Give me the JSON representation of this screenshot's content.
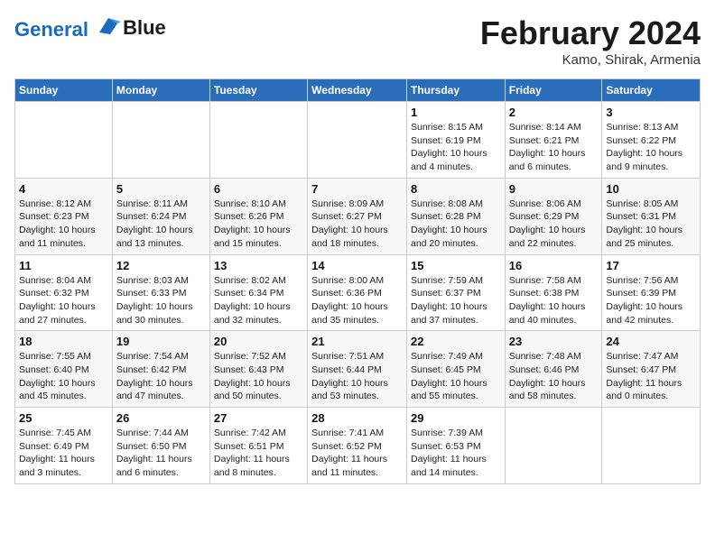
{
  "logo": {
    "line1": "General",
    "line2": "Blue"
  },
  "title": "February 2024",
  "subtitle": "Kamo, Shirak, Armenia",
  "days_of_week": [
    "Sunday",
    "Monday",
    "Tuesday",
    "Wednesday",
    "Thursday",
    "Friday",
    "Saturday"
  ],
  "weeks": [
    [
      {
        "day": "",
        "detail": ""
      },
      {
        "day": "",
        "detail": ""
      },
      {
        "day": "",
        "detail": ""
      },
      {
        "day": "",
        "detail": ""
      },
      {
        "day": "1",
        "detail": "Sunrise: 8:15 AM\nSunset: 6:19 PM\nDaylight: 10 hours\nand 4 minutes."
      },
      {
        "day": "2",
        "detail": "Sunrise: 8:14 AM\nSunset: 6:21 PM\nDaylight: 10 hours\nand 6 minutes."
      },
      {
        "day": "3",
        "detail": "Sunrise: 8:13 AM\nSunset: 6:22 PM\nDaylight: 10 hours\nand 9 minutes."
      }
    ],
    [
      {
        "day": "4",
        "detail": "Sunrise: 8:12 AM\nSunset: 6:23 PM\nDaylight: 10 hours\nand 11 minutes."
      },
      {
        "day": "5",
        "detail": "Sunrise: 8:11 AM\nSunset: 6:24 PM\nDaylight: 10 hours\nand 13 minutes."
      },
      {
        "day": "6",
        "detail": "Sunrise: 8:10 AM\nSunset: 6:26 PM\nDaylight: 10 hours\nand 15 minutes."
      },
      {
        "day": "7",
        "detail": "Sunrise: 8:09 AM\nSunset: 6:27 PM\nDaylight: 10 hours\nand 18 minutes."
      },
      {
        "day": "8",
        "detail": "Sunrise: 8:08 AM\nSunset: 6:28 PM\nDaylight: 10 hours\nand 20 minutes."
      },
      {
        "day": "9",
        "detail": "Sunrise: 8:06 AM\nSunset: 6:29 PM\nDaylight: 10 hours\nand 22 minutes."
      },
      {
        "day": "10",
        "detail": "Sunrise: 8:05 AM\nSunset: 6:31 PM\nDaylight: 10 hours\nand 25 minutes."
      }
    ],
    [
      {
        "day": "11",
        "detail": "Sunrise: 8:04 AM\nSunset: 6:32 PM\nDaylight: 10 hours\nand 27 minutes."
      },
      {
        "day": "12",
        "detail": "Sunrise: 8:03 AM\nSunset: 6:33 PM\nDaylight: 10 hours\nand 30 minutes."
      },
      {
        "day": "13",
        "detail": "Sunrise: 8:02 AM\nSunset: 6:34 PM\nDaylight: 10 hours\nand 32 minutes."
      },
      {
        "day": "14",
        "detail": "Sunrise: 8:00 AM\nSunset: 6:36 PM\nDaylight: 10 hours\nand 35 minutes."
      },
      {
        "day": "15",
        "detail": "Sunrise: 7:59 AM\nSunset: 6:37 PM\nDaylight: 10 hours\nand 37 minutes."
      },
      {
        "day": "16",
        "detail": "Sunrise: 7:58 AM\nSunset: 6:38 PM\nDaylight: 10 hours\nand 40 minutes."
      },
      {
        "day": "17",
        "detail": "Sunrise: 7:56 AM\nSunset: 6:39 PM\nDaylight: 10 hours\nand 42 minutes."
      }
    ],
    [
      {
        "day": "18",
        "detail": "Sunrise: 7:55 AM\nSunset: 6:40 PM\nDaylight: 10 hours\nand 45 minutes."
      },
      {
        "day": "19",
        "detail": "Sunrise: 7:54 AM\nSunset: 6:42 PM\nDaylight: 10 hours\nand 47 minutes."
      },
      {
        "day": "20",
        "detail": "Sunrise: 7:52 AM\nSunset: 6:43 PM\nDaylight: 10 hours\nand 50 minutes."
      },
      {
        "day": "21",
        "detail": "Sunrise: 7:51 AM\nSunset: 6:44 PM\nDaylight: 10 hours\nand 53 minutes."
      },
      {
        "day": "22",
        "detail": "Sunrise: 7:49 AM\nSunset: 6:45 PM\nDaylight: 10 hours\nand 55 minutes."
      },
      {
        "day": "23",
        "detail": "Sunrise: 7:48 AM\nSunset: 6:46 PM\nDaylight: 10 hours\nand 58 minutes."
      },
      {
        "day": "24",
        "detail": "Sunrise: 7:47 AM\nSunset: 6:47 PM\nDaylight: 11 hours\nand 0 minutes."
      }
    ],
    [
      {
        "day": "25",
        "detail": "Sunrise: 7:45 AM\nSunset: 6:49 PM\nDaylight: 11 hours\nand 3 minutes."
      },
      {
        "day": "26",
        "detail": "Sunrise: 7:44 AM\nSunset: 6:50 PM\nDaylight: 11 hours\nand 6 minutes."
      },
      {
        "day": "27",
        "detail": "Sunrise: 7:42 AM\nSunset: 6:51 PM\nDaylight: 11 hours\nand 8 minutes."
      },
      {
        "day": "28",
        "detail": "Sunrise: 7:41 AM\nSunset: 6:52 PM\nDaylight: 11 hours\nand 11 minutes."
      },
      {
        "day": "29",
        "detail": "Sunrise: 7:39 AM\nSunset: 6:53 PM\nDaylight: 11 hours\nand 14 minutes."
      },
      {
        "day": "",
        "detail": ""
      },
      {
        "day": "",
        "detail": ""
      }
    ]
  ]
}
